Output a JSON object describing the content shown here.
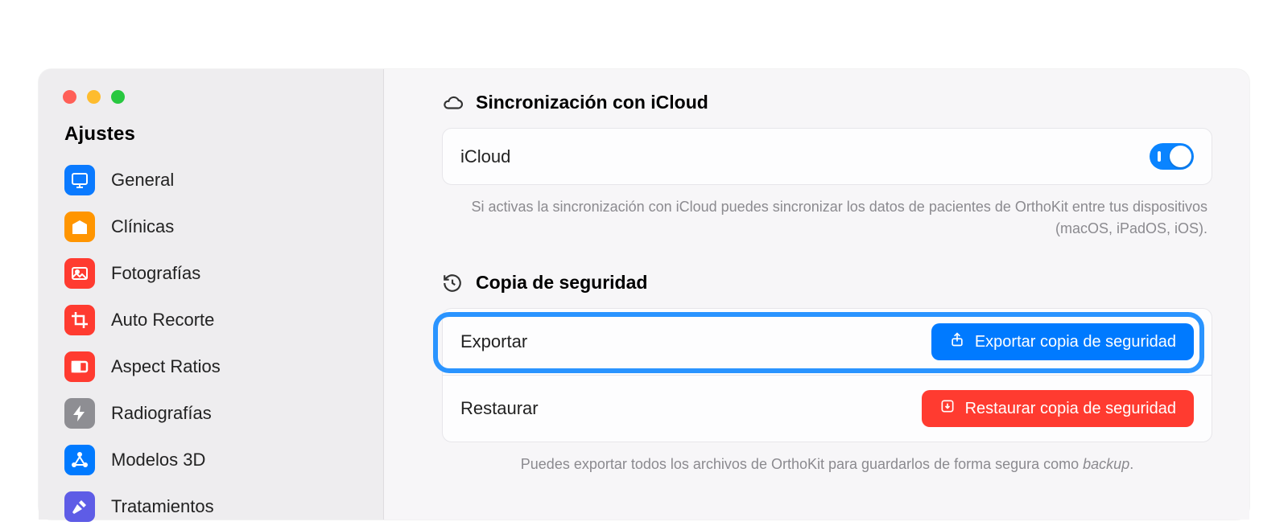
{
  "sidebar": {
    "title": "Ajustes",
    "items": [
      {
        "label": "General",
        "icon": "display-icon",
        "color": "#0a7aff"
      },
      {
        "label": "Clínicas",
        "icon": "building-icon",
        "color": "#ff9500"
      },
      {
        "label": "Fotografías",
        "icon": "photo-icon",
        "color": "#ff3b30"
      },
      {
        "label": "Auto Recorte",
        "icon": "crop-icon",
        "color": "#ff3b30"
      },
      {
        "label": "Aspect Ratios",
        "icon": "ratio-icon",
        "color": "#ff3b30"
      },
      {
        "label": "Radiografías",
        "icon": "bolt-icon",
        "color": "#8e8e93"
      },
      {
        "label": "Modelos 3D",
        "icon": "network-icon",
        "color": "#007aff"
      },
      {
        "label": "Tratamientos",
        "icon": "hammer-icon",
        "color": "#5e5ce6"
      }
    ]
  },
  "sections": {
    "icloud": {
      "title": "Sincronización con iCloud",
      "row_label": "iCloud",
      "toggle_on": true,
      "helper": "Si activas la sincronización con iCloud puedes sincronizar los datos de pacientes de OrthoKit entre tus dispositivos (macOS, iPadOS, iOS)."
    },
    "backup": {
      "title": "Copia de seguridad",
      "export_label": "Exportar",
      "export_button": "Exportar copia de seguridad",
      "restore_label": "Restaurar",
      "restore_button": "Restaurar copia de seguridad",
      "helper_prefix": "Puedes exportar todos los archivos de OrthoKit para guardarlos de forma segura como ",
      "helper_italic": "backup",
      "helper_suffix": "."
    }
  }
}
